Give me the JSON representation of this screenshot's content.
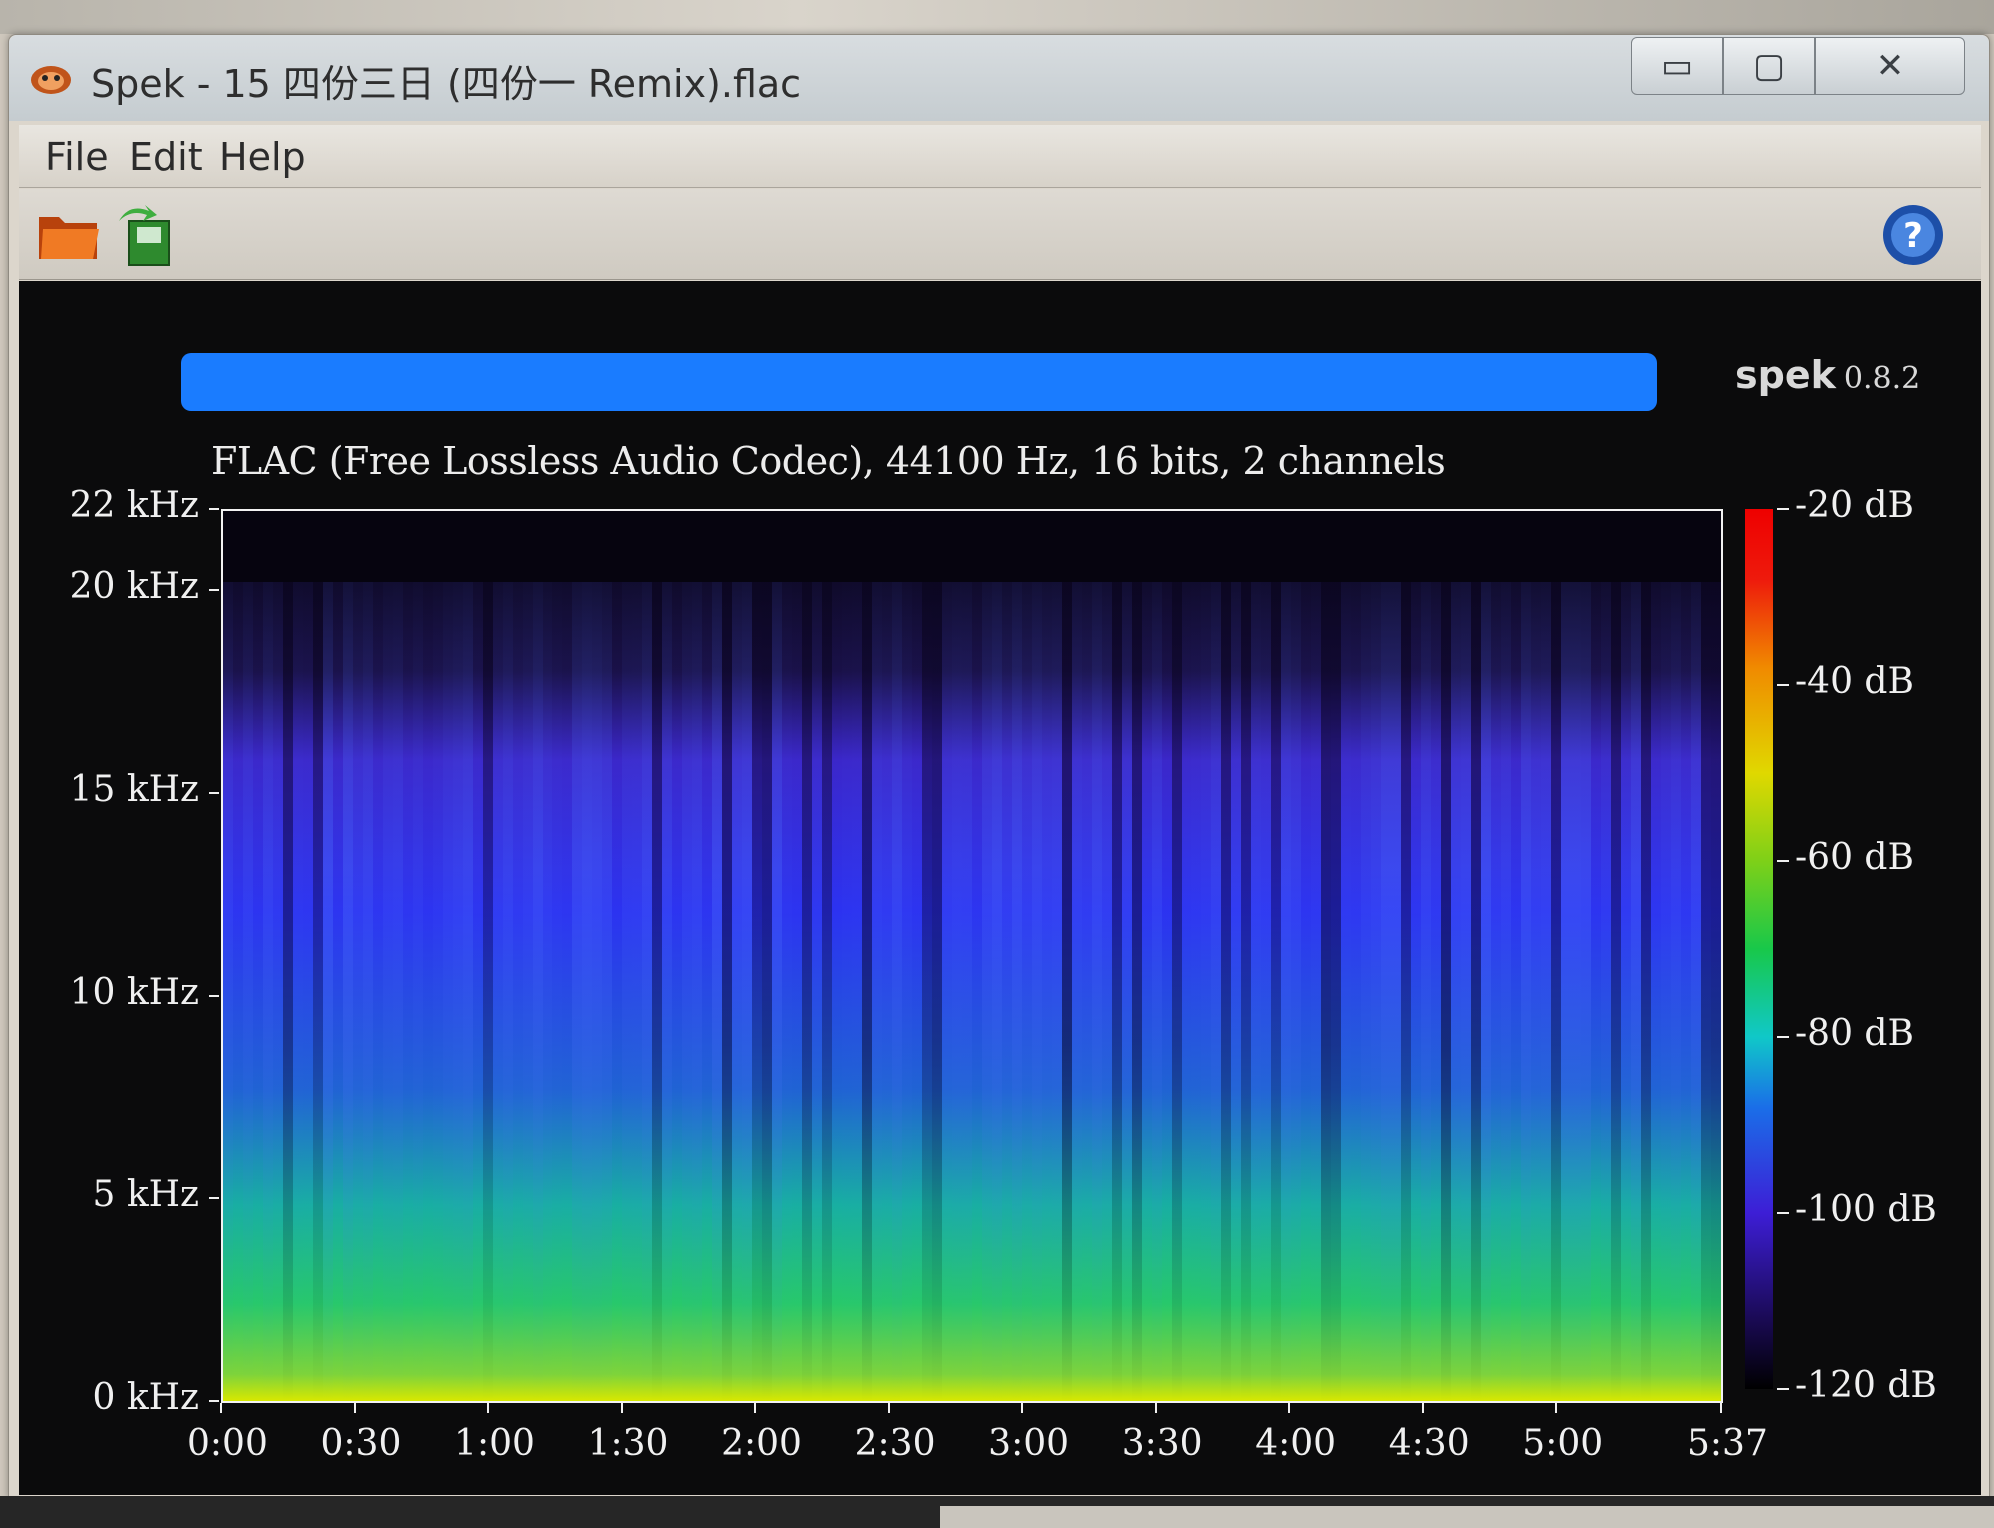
{
  "window": {
    "title": "Spek - 15 四份三日 (四份一 Remix).flac",
    "buttons": {
      "minimize": "▭",
      "maximize": "▢",
      "close": "✕"
    }
  },
  "menu": [
    "File",
    "Edit",
    "Help"
  ],
  "toolbar": {
    "open_icon": "folder-icon",
    "save_icon": "save-icon",
    "help_icon": "help-icon"
  },
  "brand": {
    "name": "spek",
    "version": "0.8.2"
  },
  "file_info": "FLAC (Free Lossless Audio Codec), 44100 Hz, 16 bits, 2 channels",
  "colors": {
    "redaction": "#1a7cff",
    "background": "#0b0b0c",
    "axis": "#f0f0f0"
  },
  "chart_data": {
    "type": "heatmap",
    "y_ticks": [
      "22 kHz",
      "20 kHz",
      "15 kHz",
      "10 kHz",
      "5 kHz",
      "0 kHz"
    ],
    "y_values": [
      22,
      20,
      15,
      10,
      5,
      0
    ],
    "ylim": [
      0,
      22
    ],
    "x_ticks": [
      "0:00",
      "0:30",
      "1:00",
      "1:30",
      "2:00",
      "2:30",
      "3:00",
      "3:30",
      "4:00",
      "4:30",
      "5:00",
      "5:37"
    ],
    "x_values": [
      0,
      30,
      60,
      90,
      120,
      150,
      180,
      210,
      240,
      270,
      300,
      337
    ],
    "xlim": [
      0,
      337
    ],
    "colorbar_ticks": [
      "-20 dB",
      "-40 dB",
      "-60 dB",
      "-80 dB",
      "-100 dB",
      "-120 dB"
    ],
    "colorbar_values": [
      -20,
      -40,
      -60,
      -80,
      -100,
      -120
    ],
    "colorbar_range": [
      -120,
      -20
    ]
  }
}
